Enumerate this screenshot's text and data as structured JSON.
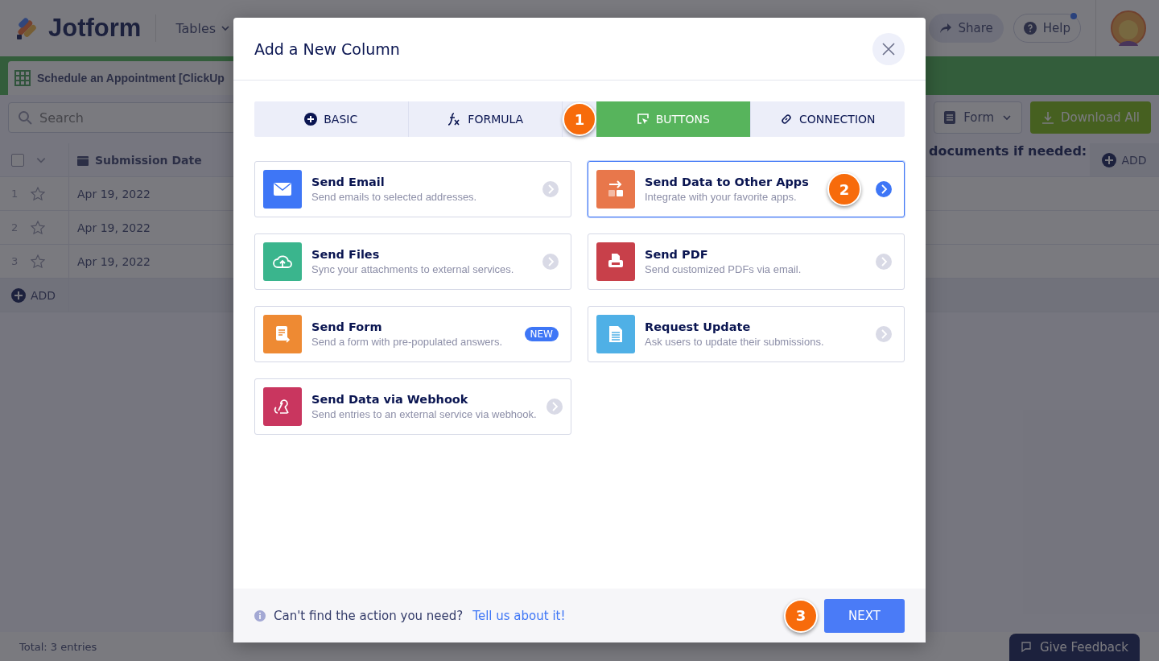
{
  "header": {
    "logo": "Jotform",
    "menu": "Tables",
    "share": "Share",
    "help": "Help"
  },
  "table_tab": {
    "label": "Schedule an Appointment [ClickUp"
  },
  "toolbar": {
    "search": {
      "placeholder": "Search"
    },
    "form_dropdown": "Form",
    "download": "Download All"
  },
  "table": {
    "select_all": {
      "checked": false
    },
    "columns": [
      {
        "label": "Submission Date"
      },
      {
        "label": "documents if needed:"
      }
    ],
    "add_column": "ADD",
    "rows": [
      {
        "number": "1",
        "date": "Apr 19, 2022"
      },
      {
        "number": "2",
        "date": "Apr 19, 2022"
      },
      {
        "number": "3",
        "date": "Apr 19, 2022"
      }
    ],
    "add_row": "ADD"
  },
  "status_bar": "Total: 3 entries",
  "feedback": "Give Feedback",
  "modal": {
    "title": "Add a New Column",
    "tabs": [
      {
        "label": "BASIC",
        "kind": "basic",
        "selected": false
      },
      {
        "label": "FORMULA",
        "kind": "formula",
        "selected": false
      },
      {
        "label": "BUTTONS",
        "kind": "buttons",
        "selected": true
      },
      {
        "label": "CONNECTION",
        "kind": "connection",
        "selected": false
      }
    ],
    "tab_step": "1",
    "options": [
      {
        "title": "Send Email",
        "description": "Send emails to selected addresses.",
        "kind": "email",
        "color": "#3e76f6",
        "selected": false
      },
      {
        "title": "Send Data to Other Apps",
        "description": "Integrate with your favorite apps.",
        "kind": "apps",
        "color": "#e8774b",
        "selected": true,
        "step": "2"
      },
      {
        "title": "Send Files",
        "description": "Sync your attachments to external services.",
        "kind": "files",
        "color": "#3ab58d",
        "selected": false
      },
      {
        "title": "Send PDF",
        "description": "Send customized PDFs via email.",
        "kind": "pdf",
        "color": "#c8404a",
        "selected": false
      },
      {
        "title": "Send Form",
        "description": "Send a form with pre-populated answers.",
        "kind": "form",
        "color": "#ee8a33",
        "selected": false,
        "badge": "NEW"
      },
      {
        "title": "Request Update",
        "description": "Ask users to update their submissions.",
        "kind": "update",
        "color": "#4fb0e6",
        "selected": false
      },
      {
        "title": "Send Data via Webhook",
        "description": "Send entries to an external service via webhook.",
        "kind": "webhook",
        "color": "#c9365f",
        "selected": false
      }
    ],
    "footer": {
      "question": "Can't find the action you need?",
      "link": "Tell us about it!"
    },
    "next": {
      "label": "NEXT",
      "step": "3"
    }
  }
}
